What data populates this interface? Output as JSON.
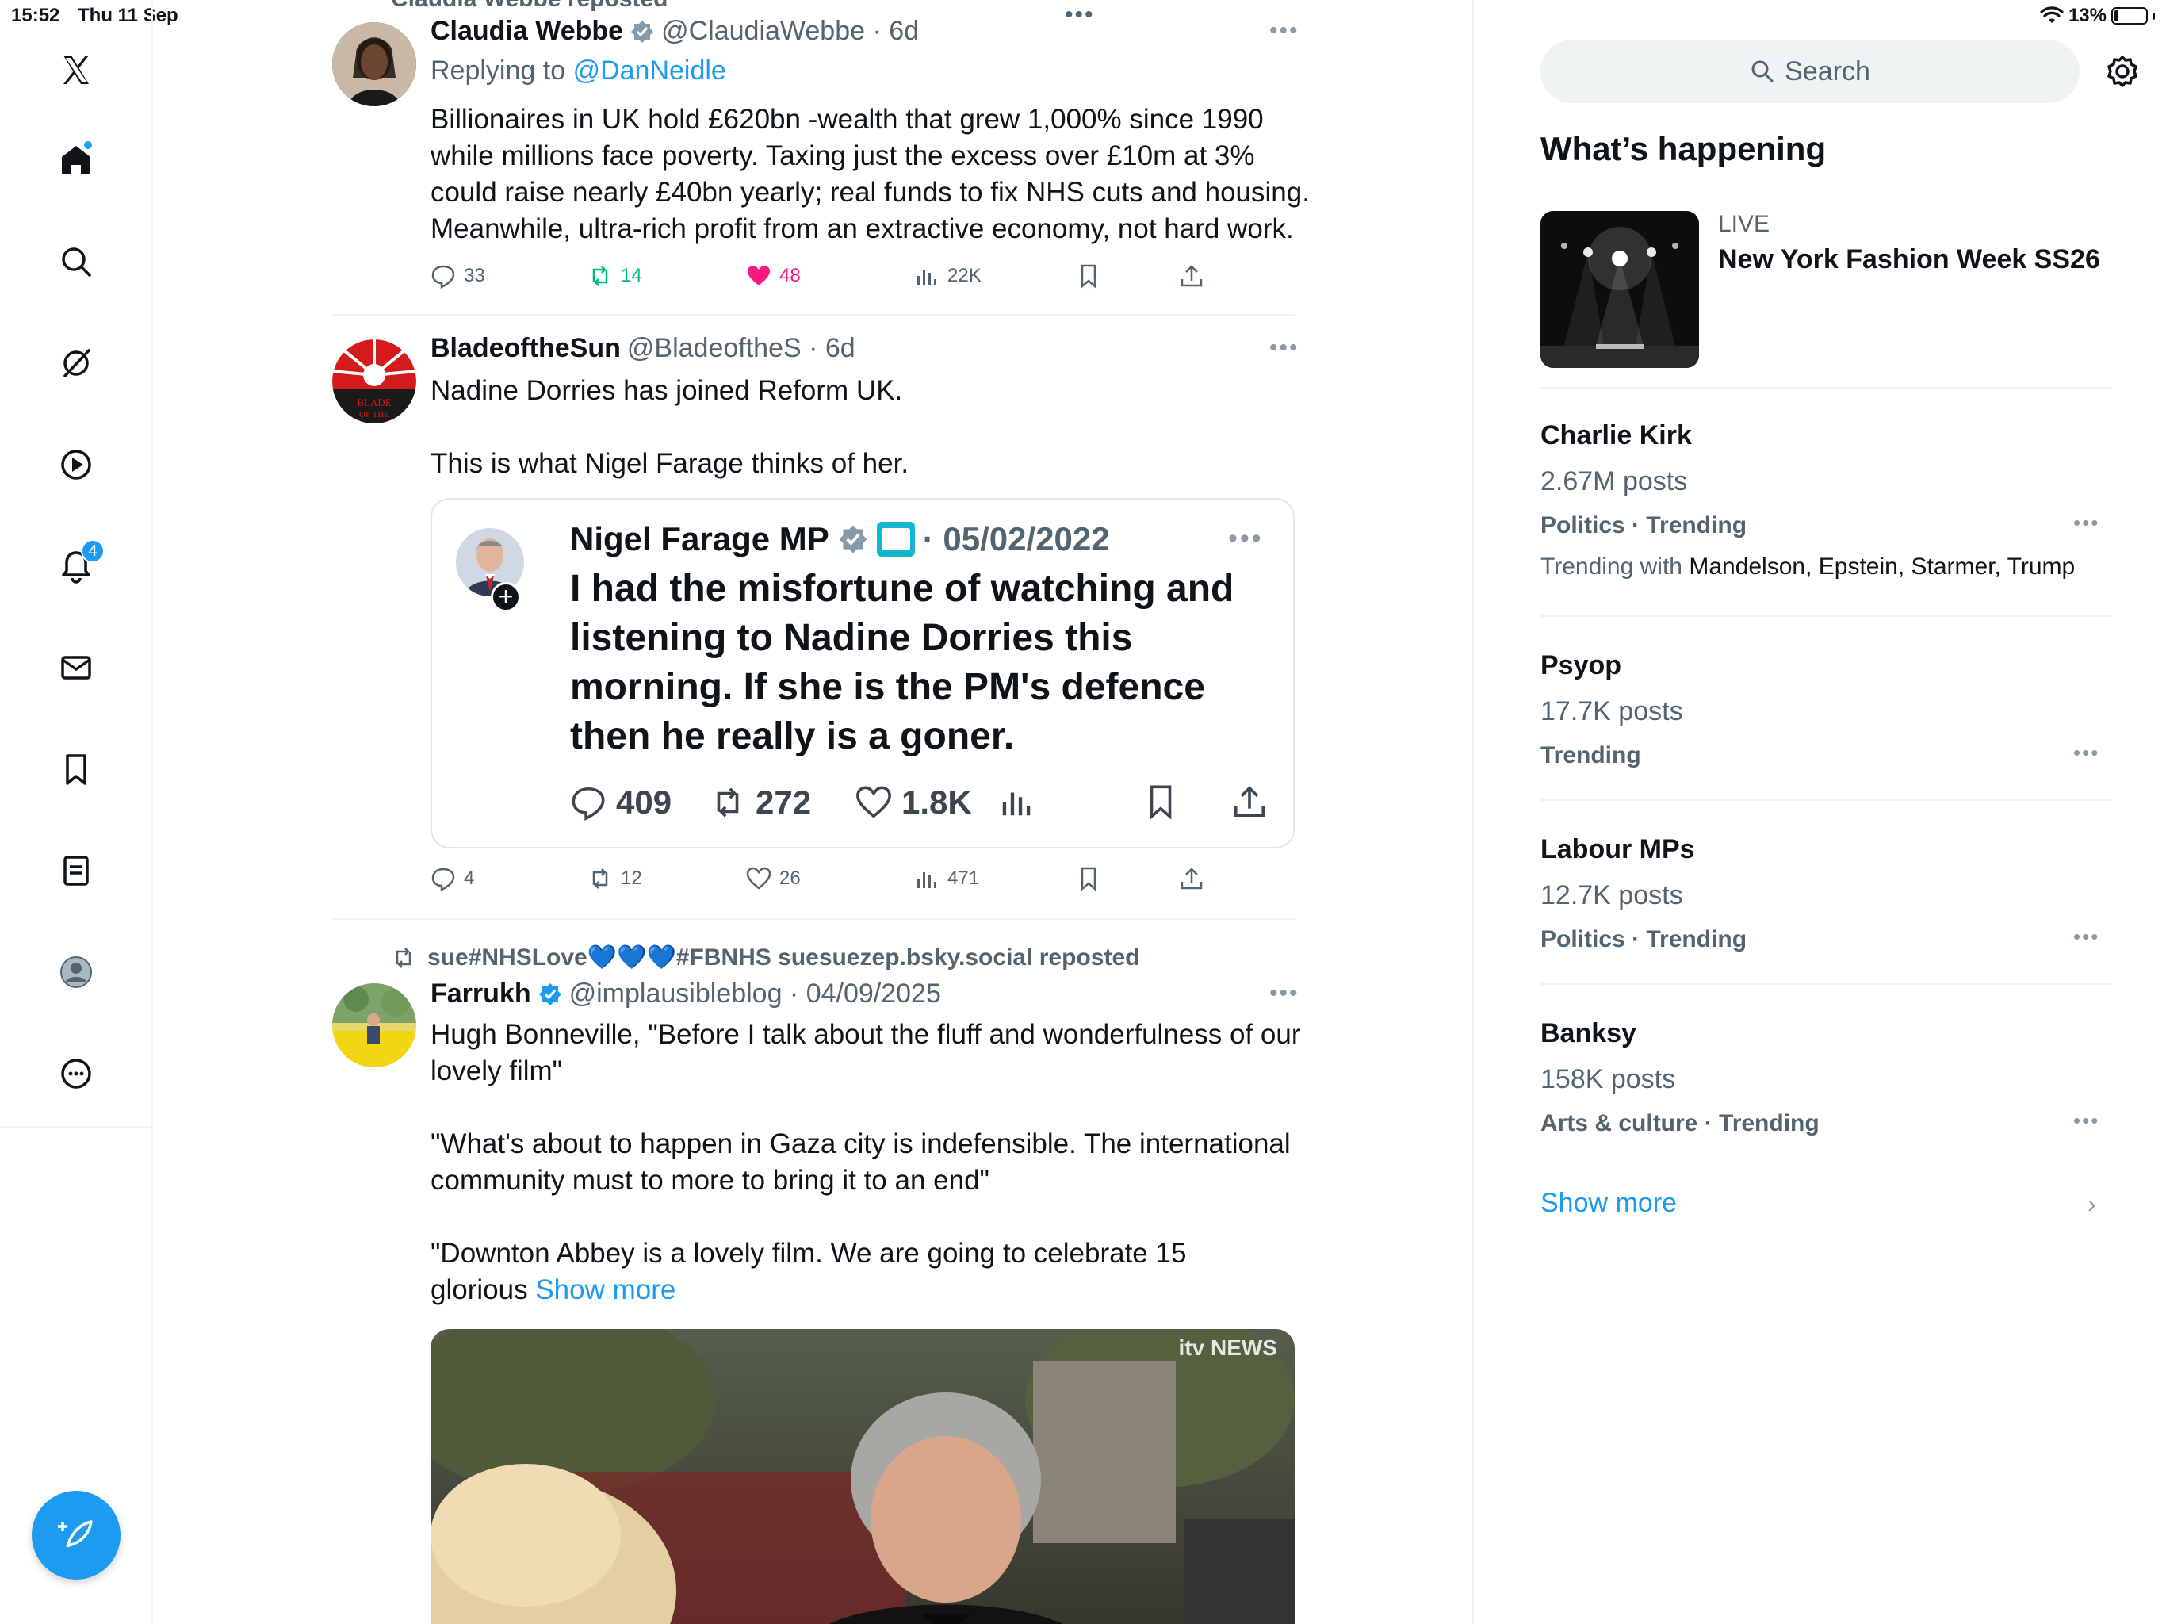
{
  "status_bar": {
    "time": "15:52",
    "date": "Thu 11 Sep",
    "battery": "13%"
  },
  "nav": {
    "notifications_badge": "4"
  },
  "feed": {
    "top_repost_label": "Claudia Webbe reposted",
    "top_ellipsis": "•••",
    "tweets": [
      {
        "name": "Claudia Webbe",
        "handle": "@ClaudiaWebbe · 6d",
        "replying_to_label": "Replying to",
        "replying_to_handle": "@DanNeidle",
        "text_lines": [
          "Billionaires in UK hold £620bn -wealth that grew 1,000% since 1990",
          "while millions face poverty. Taxing just the excess over £10m at 3%",
          "could raise nearly £40bn yearly; real funds to fix NHS cuts and housing.",
          "Meanwhile, ultra-rich profit from an extractive economy, not hard work."
        ],
        "replies": "33",
        "reposts": "14",
        "likes": "48",
        "views": "22K"
      },
      {
        "name": "BladeoftheSun",
        "handle": "@BladeoftheS · 6d",
        "avatar_text": "BLADE OF THE",
        "text_lines": [
          "Nadine Dorries has joined Reform UK.",
          "",
          "This is what Nigel Farage thinks of her."
        ],
        "quote": {
          "name": "Nigel Farage MP",
          "date": "· 05/02/2022",
          "text_lines": [
            "I had the misfortune of watching and",
            "listening to Nadine Dorries this",
            "morning. If she is the PM's defence",
            "then he really is a goner."
          ],
          "replies": "409",
          "reposts": "272",
          "likes": "1.8K"
        },
        "replies": "4",
        "reposts": "12",
        "likes": "26",
        "views": "471"
      },
      {
        "repost_label": "sue#NHSLove💙💙💙#FBNHS suesuezep.bsky.social reposted",
        "name": "Farrukh",
        "handle": "@implausibleblog · 04/09/2025",
        "text_lines": [
          "Hugh Bonneville, \"Before I talk about the fluff and wonderfulness of our",
          "lovely film\"",
          "",
          "\"What's about to happen in Gaza city is indefensible. The international",
          "community must to more to bring it to an end\"",
          "",
          "\"Downton Abbey is a lovely film. We are going to celebrate 15"
        ],
        "last_line_prefix": "glorious",
        "show_more": "Show more",
        "media_watermark": "itv NEWS"
      }
    ]
  },
  "sidebar": {
    "search_placeholder": "Search",
    "heading": "What’s happening",
    "live": {
      "tag": "LIVE",
      "title": "New York Fashion Week SS26"
    },
    "trends": [
      {
        "name": "Charlie Kirk",
        "count": "2.67M posts",
        "meta": "Politics · Trending",
        "with_label": "Trending with",
        "with": "Mandelson, Epstein, Starmer, Trump"
      },
      {
        "name": "Psyop",
        "count": "17.7K posts",
        "meta": "Trending"
      },
      {
        "name": "Labour MPs",
        "count": "12.7K posts",
        "meta": "Politics · Trending"
      },
      {
        "name": "Banksy",
        "count": "158K posts",
        "meta": "Arts & culture · Trending"
      }
    ],
    "show_more": "Show more"
  },
  "colors": {
    "accent": "#1d9bf0",
    "like": "#f91880",
    "repost": "#00ba7c",
    "muted": "#536471"
  }
}
